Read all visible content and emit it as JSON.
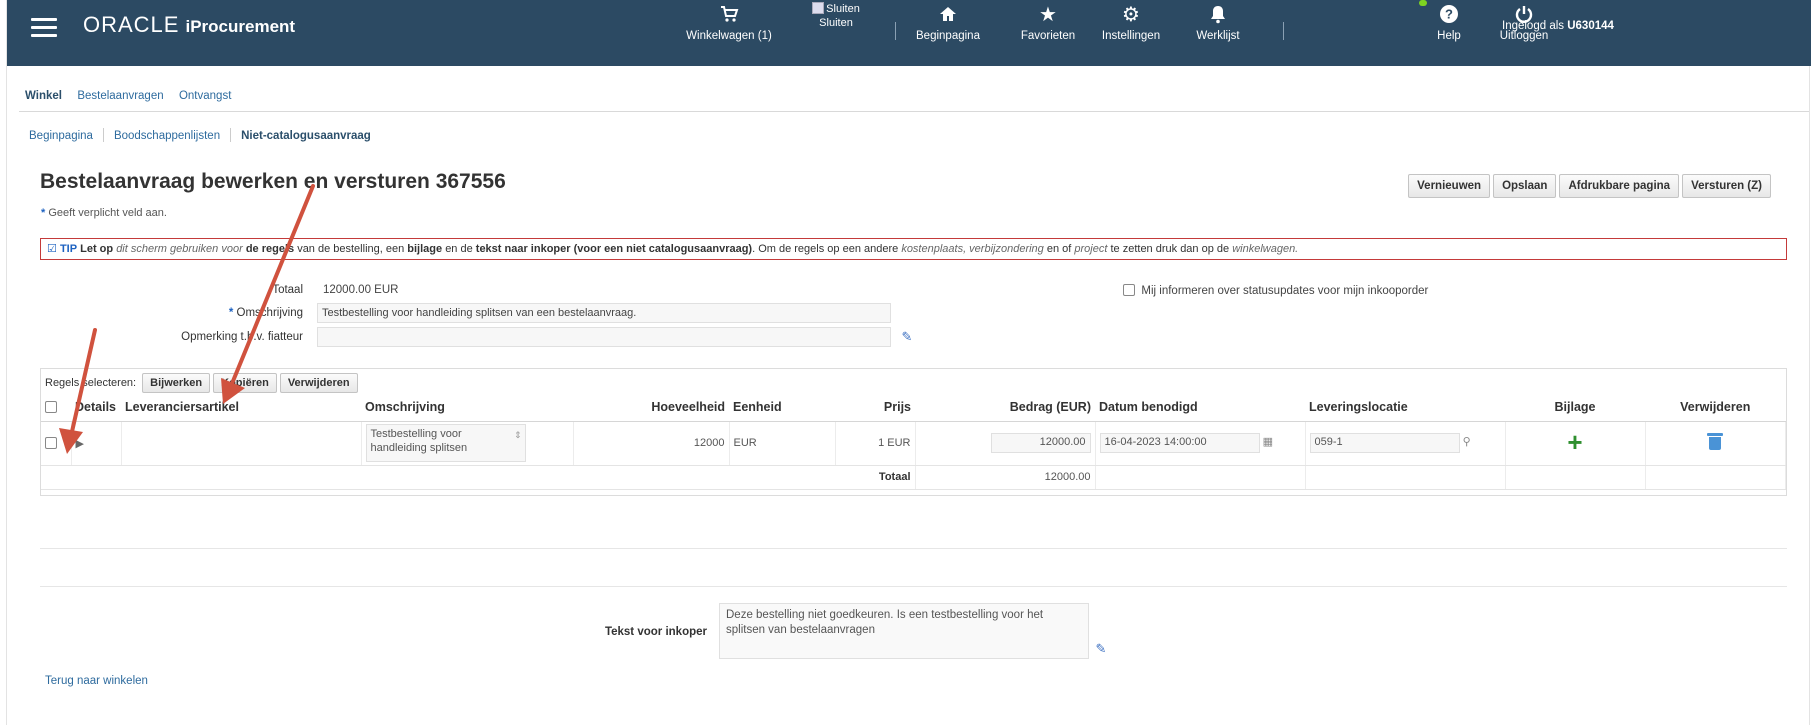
{
  "header": {
    "brand": "ORACLE",
    "app_name": "iProcurement",
    "nav": {
      "cart": "Winkelwagen (1)",
      "close": "Sluiten",
      "close_img_alt": "Sluiten",
      "home": "Beginpagina",
      "favorites": "Favorieten",
      "settings": "Instellingen",
      "worklist": "Werklijst",
      "logged_in_prefix": "Ingelogd als",
      "username": "U630144",
      "help": "Help",
      "logout": "Uitloggen"
    }
  },
  "tabs": [
    "Winkel",
    "Bestelaanvragen",
    "Ontvangst"
  ],
  "subnav": [
    "Beginpagina",
    "Boodschappenlijsten",
    "Niet-catalogusaanvraag"
  ],
  "page": {
    "title": "Bestelaanvraag bewerken en versturen 367556",
    "buttons": [
      "Vernieuwen",
      "Opslaan",
      "Afdrukbare pagina",
      "Versturen (Z)"
    ],
    "required_note": "Geeft verplicht veld aan.",
    "tip": {
      "label": "TIP",
      "p1": "Let op",
      "p2": "dit scherm gebruiken voor",
      "p3": "de regels",
      "p4": "van de bestelling, een",
      "p5": "bijlage",
      "p6": "en de",
      "p7": "tekst naar inkoper (voor een niet catalogusaanvraag)",
      "p8": ". Om de regels op een andere",
      "p9": "kostenplaats, verbijzondering",
      "p10": "en of",
      "p11": "project",
      "p12": "te zetten druk dan op de",
      "p13": "winkelwagen."
    }
  },
  "form": {
    "total_label": "Totaal",
    "total_value": "12000.00 EUR",
    "description_label": "Omschrijving",
    "description_value": "Testbestelling voor handleiding splitsen van een bestelaanvraag.",
    "approver_note_label": "Opmerking t.b.v. fiatteur",
    "approver_note_value": "",
    "notify_label": "Mij informeren over statusupdates voor mijn inkooporder"
  },
  "lines": {
    "select_label": "Regels selecteren:",
    "actions": [
      "Bijwerken",
      "Kopiëren",
      "Verwijderen"
    ],
    "columns": [
      "Details",
      "Leveranciersartikel",
      "Omschrijving",
      "Hoeveelheid",
      "Eenheid",
      "Prijs",
      "Bedrag (EUR)",
      "Datum benodigd",
      "Leveringslocatie",
      "Bijlage",
      "Verwijderen"
    ],
    "rows": [
      {
        "supplier_item": "",
        "description": "Testbestelling voor handleiding splitsen",
        "quantity": "12000",
        "unit": "EUR",
        "price": "1 EUR",
        "amount": "12000.00",
        "date_needed": "16-04-2023 14:00:00",
        "location": "059-1"
      }
    ],
    "total_label": "Totaal",
    "total_value": "12000.00"
  },
  "buyer_note": {
    "label": "Tekst voor inkoper",
    "value": "Deze bestelling niet goedkeuren. Is een testbestelling voor het splitsen van bestelaanvragen"
  },
  "back_link": "Terug naar winkelen",
  "colors": {
    "header_bg": "#2c4a63",
    "link": "#2e6b9e",
    "tip_border": "#c43a3a",
    "annotation_arrow": "#d0523e",
    "add_icon": "#2f8f2f",
    "delete_icon": "#4a93d6"
  }
}
